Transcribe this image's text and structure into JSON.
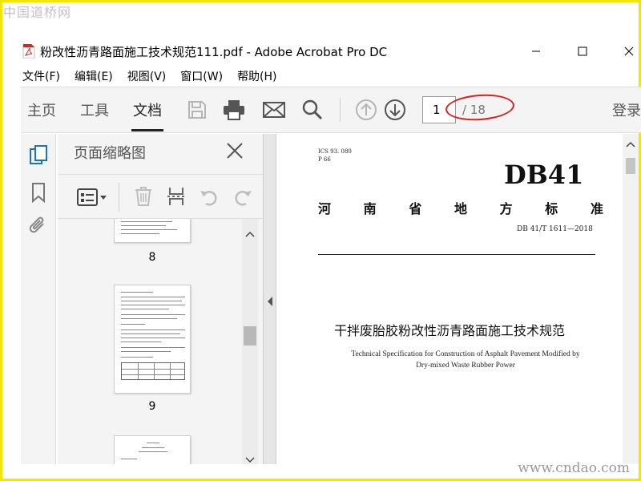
{
  "watermark": {
    "top": "中国道桥网",
    "bottom": "www.cndao.com"
  },
  "window": {
    "title": "粉改性沥青路面施工技术规范111.pdf - Adobe Acrobat Pro DC"
  },
  "menu": [
    "文件(F)",
    "编辑(E)",
    "视图(V)",
    "窗口(W)",
    "帮助(H)"
  ],
  "toolbar": {
    "tabs": [
      "主页",
      "工具",
      "文档"
    ],
    "active_tab": "文档",
    "page_current": "1",
    "page_total": "/ 18",
    "login": "登录"
  },
  "thumbnail_panel": {
    "title": "页面缩略图",
    "pages": [
      "8",
      "9"
    ]
  },
  "document": {
    "ics": "ICS   93. 080",
    "p": "P   66",
    "standard": "DB41",
    "province_chars": [
      "河",
      "南",
      "省",
      "地",
      "方",
      "标",
      "准"
    ],
    "code": "DB 41/T  1611—2018",
    "title_cn": "干拌废胎胶粉改性沥青路面施工技术规范",
    "title_en_1": "Technical Specification for Construction of Asphalt Pavement Modified by",
    "title_en_2": "Dry-mixed Waste Rubber Power"
  },
  "colors": {
    "highlight_ellipse": "#e21b1b",
    "frame": "#f3e600"
  }
}
